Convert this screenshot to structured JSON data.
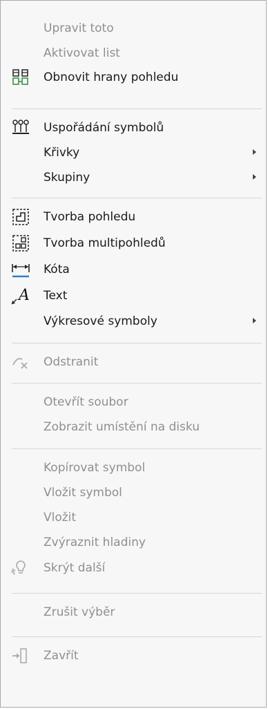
{
  "menu": {
    "edit_this": "Upravit toto",
    "activate_sheet": "Aktivovat list",
    "restore_view_edges": "Obnovit hrany pohledu",
    "symbol_arrangement": "Uspořádání symbolů",
    "curves": "Křivky",
    "groups": "Skupiny",
    "view_creation": "Tvorba pohledu",
    "multiview_creation": "Tvorba multipohledů",
    "dimension": "Kóta",
    "text": "Text",
    "drawing_symbols": "Výkresové symboly",
    "remove": "Odstranit",
    "open_file": "Otevřít soubor",
    "show_location": "Zobrazit umístění na disku",
    "copy_symbol": "Kopírovat symbol",
    "paste_symbol": "Vložit symbol",
    "paste": "Vložit",
    "highlight_layers": "Zvýraznit hladiny",
    "hide_other": "Skrýt další",
    "cancel_selection": "Zrušit výběr",
    "close": "Zavřít"
  },
  "icons": {
    "restore_view_edges": "restore-view-edges-icon",
    "symbol_arrangement": "symbol-arrangement-icon",
    "view_creation": "view-creation-icon",
    "multiview_creation": "multiview-creation-icon",
    "dimension": "dimension-icon",
    "text": "text-icon",
    "remove": "remove-icon",
    "hide_other": "hide-other-icon",
    "close": "close-icon"
  },
  "colors": {
    "enabled_text": "#1a1a1a",
    "disabled_text": "#8f8f8f",
    "icon_green": "#2e8b3a",
    "icon_blue": "#2f7fc7"
  }
}
